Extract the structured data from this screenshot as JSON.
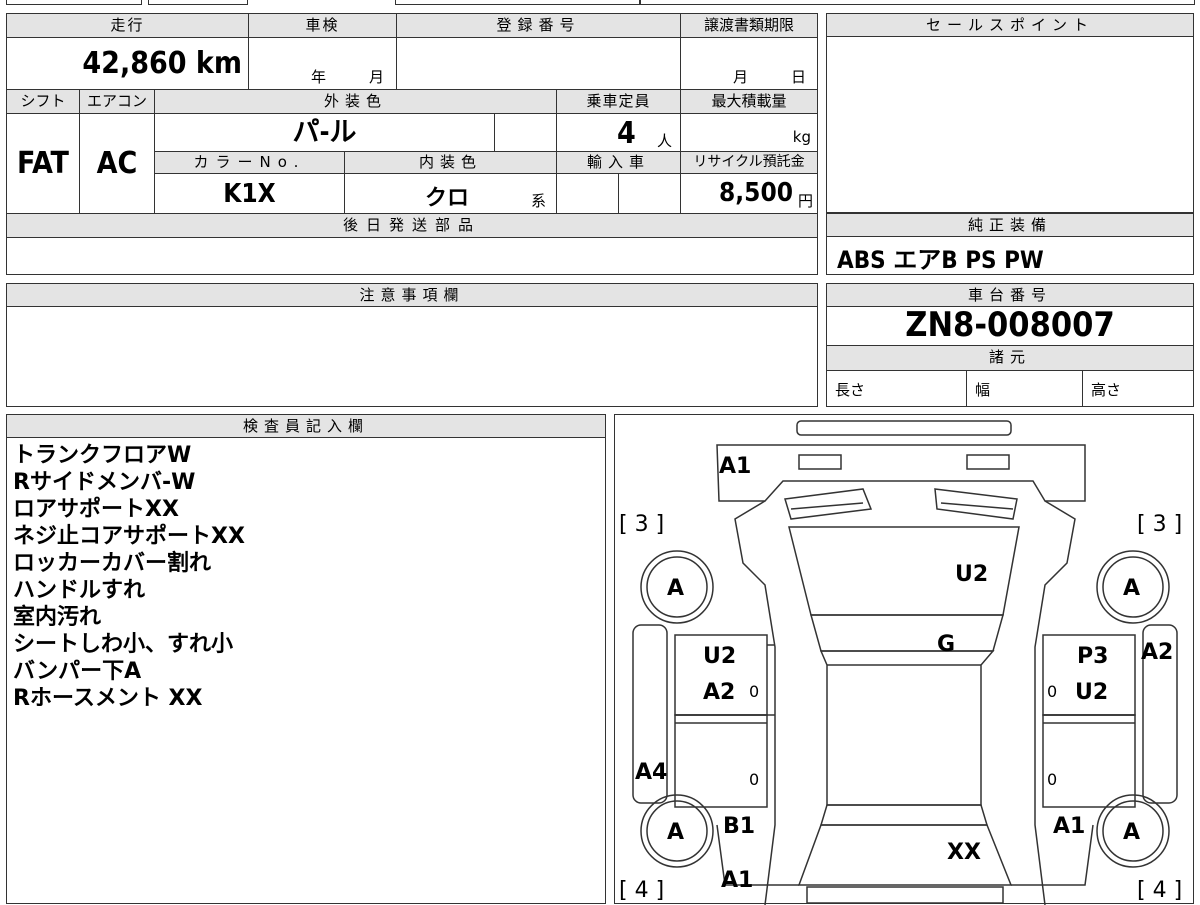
{
  "top_left": {
    "mileage_label": "走行",
    "mileage_value": "42,860 km",
    "shaken_label": "車検",
    "shaken_year": "年",
    "shaken_month": "月",
    "reg_label": "登録番号",
    "transfer_label": "譲渡書類期限",
    "transfer_month": "月",
    "transfer_day": "日",
    "shift_label": "シフト",
    "shift_value": "FAT",
    "ac_label": "エアコン",
    "ac_value": "AC",
    "exterior_label": "外装色",
    "exterior_value": "パ-ル",
    "capacity_label": "乗車定員",
    "capacity_value": "4",
    "capacity_unit": "人",
    "maxload_label": "最大積載量",
    "maxload_unit": "kg",
    "colorno_label": "カラーNo.",
    "colorno_value": "K1X",
    "interior_label": "内装色",
    "interior_value": "クロ",
    "interior_suffix": "系",
    "import_label": "輸入車",
    "recycle_label": "リサイクル預託金",
    "recycle_value": "8,500",
    "recycle_unit": "円",
    "later_parts_label": "後日発送部品"
  },
  "sales_point": {
    "label": "セールスポイント"
  },
  "equipment": {
    "label": "純正装備",
    "value": "ABS エアB PS PW"
  },
  "caution": {
    "label": "注意事項欄"
  },
  "chassis": {
    "label": "車台番号",
    "value": "ZN8-008007"
  },
  "specs": {
    "label": "諸元",
    "length": "長さ",
    "width": "幅",
    "height": "高さ"
  },
  "inspector": {
    "label": "検査員記入欄",
    "notes": [
      "トランクフロアW",
      "Rサイドメンバ-W",
      "ロアサポートXX",
      "ネジ止コアサポートXX",
      "ロッカーカバー割れ",
      "ハンドルすれ",
      "室内汚れ",
      "シートしわ小、すれ小",
      "バンパー下A",
      "Rホースメント XX"
    ]
  },
  "diagram": {
    "front": "A1",
    "hood": "U2",
    "roof": "G",
    "left_front_door_1": "U2",
    "left_front_door_2": "A2",
    "right_front_door_1": "P3",
    "right_front_door_2": "U2",
    "right_fender": "A2",
    "left_rear": "A4",
    "left_rear_door": "B1",
    "right_rear_door": "A1",
    "trunk": "XX",
    "rear_bumper": "A1",
    "tire_fl": "A",
    "tire_fr": "A",
    "tire_rl": "A",
    "tire_rr": "A",
    "tire_front_left_num": "[ 3 ]",
    "tire_front_right_num": "[ 3 ]",
    "tire_rear_left_num": "[ 4 ]",
    "tire_rear_right_num": "[ 4 ]",
    "zero_l1": "0",
    "zero_r1": "0",
    "zero_l2": "0",
    "zero_r2": "0"
  }
}
